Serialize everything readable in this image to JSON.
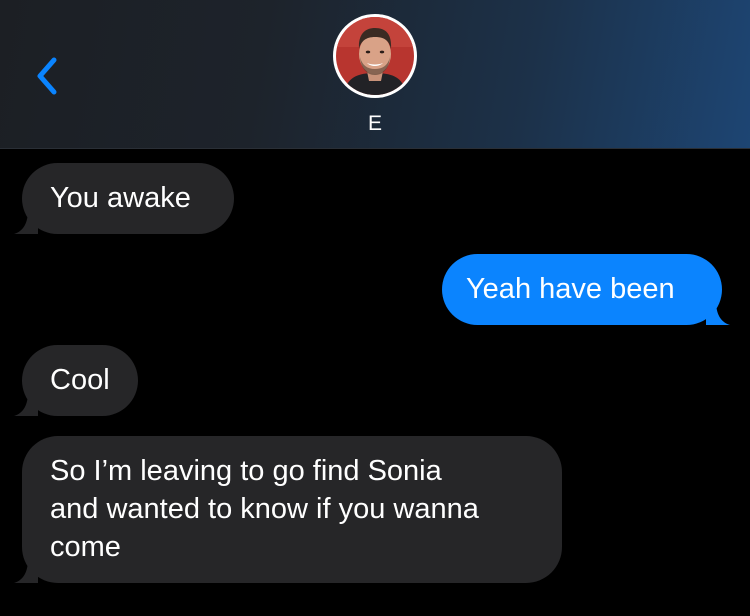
{
  "header": {
    "back_icon": "chevron-left-icon",
    "contact_name": "E",
    "avatar_icon": "contact-avatar-photo",
    "accent_color": "#0a84ff"
  },
  "colors": {
    "received_bubble": "#262628",
    "sent_bubble": "#0b84fe",
    "background": "#000000"
  },
  "messages": [
    {
      "from": "contact",
      "text": "You awake"
    },
    {
      "from": "me",
      "text": "Yeah have been"
    },
    {
      "from": "contact",
      "text": "Cool"
    },
    {
      "from": "contact",
      "text": "So I’m leaving to go find Sonia\nand wanted to know if you wanna\ncome"
    }
  ]
}
